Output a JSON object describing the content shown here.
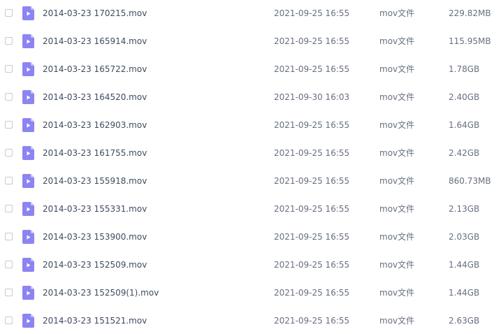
{
  "files": [
    {
      "name": "2014-03-23 170215.mov",
      "modified": "2021-09-25 16:55",
      "type": "mov文件",
      "size": "229.82MB"
    },
    {
      "name": "2014-03-23 165914.mov",
      "modified": "2021-09-25 16:55",
      "type": "mov文件",
      "size": "115.95MB"
    },
    {
      "name": "2014-03-23 165722.mov",
      "modified": "2021-09-25 16:55",
      "type": "mov文件",
      "size": "1.78GB"
    },
    {
      "name": "2014-03-23 164520.mov",
      "modified": "2021-09-30 16:03",
      "type": "mov文件",
      "size": "2.40GB"
    },
    {
      "name": "2014-03-23 162903.mov",
      "modified": "2021-09-25 16:55",
      "type": "mov文件",
      "size": "1.64GB"
    },
    {
      "name": "2014-03-23 161755.mov",
      "modified": "2021-09-25 16:55",
      "type": "mov文件",
      "size": "2.42GB"
    },
    {
      "name": "2014-03-23 155918.mov",
      "modified": "2021-09-25 16:55",
      "type": "mov文件",
      "size": "860.73MB"
    },
    {
      "name": "2014-03-23 155331.mov",
      "modified": "2021-09-25 16:55",
      "type": "mov文件",
      "size": "2.13GB"
    },
    {
      "name": "2014-03-23 153900.mov",
      "modified": "2021-09-25 16:55",
      "type": "mov文件",
      "size": "2.03GB"
    },
    {
      "name": "2014-03-23 152509.mov",
      "modified": "2021-09-25 16:55",
      "type": "mov文件",
      "size": "1.44GB"
    },
    {
      "name": "2014-03-23 152509(1).mov",
      "modified": "2021-09-25 16:55",
      "type": "mov文件",
      "size": "1.44GB"
    },
    {
      "name": "2014-03-23 151521.mov",
      "modified": "2021-09-25 16:55",
      "type": "mov文件",
      "size": "2.63GB"
    }
  ],
  "icons": {
    "file": "video-file-icon",
    "checkbox": "checkbox"
  },
  "colors": {
    "icon_fill": "#8c84f2",
    "icon_fold": "#c4c0fb",
    "icon_play": "#ffffff",
    "text": "#424e67",
    "checkbox_border": "#c6cad2"
  }
}
